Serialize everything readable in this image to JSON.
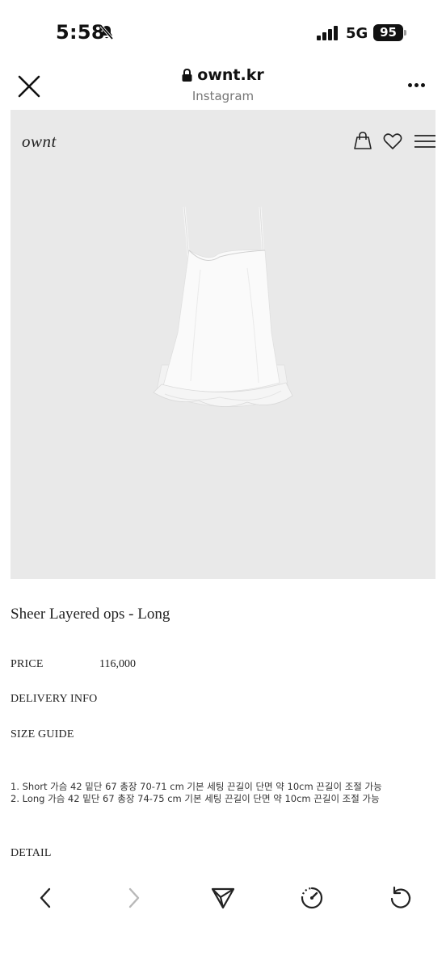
{
  "status_bar": {
    "time": "5:58",
    "network": "5G",
    "battery": "95"
  },
  "browser": {
    "url": "ownt.kr",
    "source": "Instagram"
  },
  "site": {
    "logo": "ownt"
  },
  "product": {
    "title": "Sheer Layered ops - Long",
    "price_label": "PRICE",
    "price_value": "116,000",
    "delivery_label": "DELIVERY INFO",
    "size_guide_label": "SIZE GUIDE",
    "size_lines": [
      "1. Short 가슴 42 밑단 67 총장 70-71 cm 기본 세팅 끈길이 단면 약 10cm 끈길이 조절 가능",
      "2. Long 가슴 42 밑단 67 총장 74-75 cm 기본 세팅 끈길이 단면 약 10cm 끈길이 조절 가능"
    ],
    "detail_label": "DETAIL"
  },
  "icons": {
    "close": "close-icon",
    "lock": "lock-icon",
    "more": "more-icon",
    "bag": "shopping-bag-icon",
    "heart": "heart-icon",
    "menu": "hamburger-menu-icon",
    "back": "chevron-left-icon",
    "forward": "chevron-right-icon",
    "share": "send-icon",
    "speed": "speedometer-icon",
    "reload": "reload-icon"
  },
  "colors": {
    "hero_bg": "#e9e9e9",
    "text": "#222222",
    "muted": "#777777",
    "disabled": "#b8b8b8"
  }
}
